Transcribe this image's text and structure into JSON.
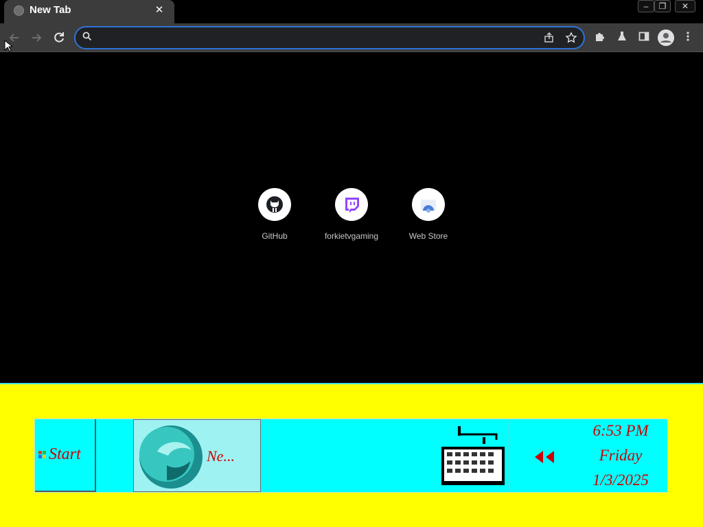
{
  "browser": {
    "tab": {
      "title": "New Tab",
      "close_glyph": "✕"
    },
    "window_controls": {
      "minimize": "–",
      "restore": "❐",
      "close": "✕"
    },
    "omnibox": {
      "value": "",
      "placeholder": ""
    },
    "accent_color": "#2f73d8"
  },
  "shortcuts": [
    {
      "label": "GitHub",
      "icon": "github-icon"
    },
    {
      "label": "forkietvgaming",
      "icon": "twitch-icon"
    },
    {
      "label": "Web Store",
      "icon": "web-store-icon"
    }
  ],
  "taskbar": {
    "start_label": "Start",
    "task_item_label": "Ne...",
    "clock": {
      "time": "6:53 PM",
      "day": "Friday",
      "date": "1/3/2025"
    },
    "colors": {
      "background": "#ffff00",
      "bar": "#00ffff",
      "text": "#cc0000"
    }
  }
}
